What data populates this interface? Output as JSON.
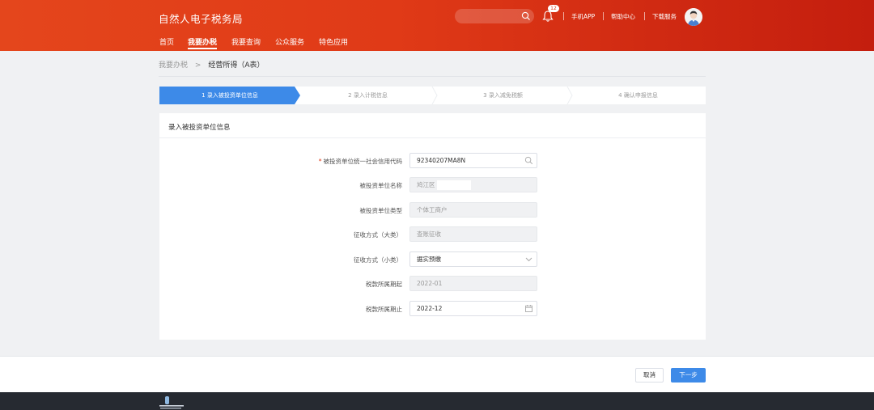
{
  "header": {
    "app_title": "自然人电子税务局",
    "notification_count": "12",
    "links": [
      "手机APP",
      "帮助中心",
      "下载服务"
    ],
    "nav": [
      "首页",
      "我要办税",
      "我要查询",
      "公众服务",
      "特色应用"
    ],
    "active_nav": "我要办税"
  },
  "breadcrumb": {
    "parent": "我要办税",
    "separator": ">",
    "current": "经营所得（A表）"
  },
  "steps": [
    {
      "label": "1  录入被投资单位信息",
      "active": true
    },
    {
      "label": "2  录入计税信息",
      "active": false
    },
    {
      "label": "3  录入减免税额",
      "active": false
    },
    {
      "label": "4  确认申报信息",
      "active": false
    }
  ],
  "card": {
    "title": "录入被投资单位信息",
    "fields": [
      {
        "label": "被投资单位统一社会信用代码",
        "required": true,
        "value": "92340207MA8N",
        "disabled": false,
        "icon": "search-icon"
      },
      {
        "label": "被投资单位名称",
        "required": false,
        "value": "鸠江区",
        "disabled": true
      },
      {
        "label": "被投资单位类型",
        "required": false,
        "value": "个体工商户",
        "disabled": true
      },
      {
        "label": "征收方式（大类）",
        "required": false,
        "value": "查账征收",
        "disabled": true
      },
      {
        "label": "征收方式（小类）",
        "required": false,
        "value": "据实预缴",
        "disabled": false,
        "icon": "chevron-down-icon"
      },
      {
        "label": "税款所属期起",
        "required": false,
        "value": "2022-01",
        "disabled": true
      },
      {
        "label": "税款所属期止",
        "required": false,
        "value": "2022-12",
        "disabled": false,
        "icon": "calendar-icon"
      }
    ]
  },
  "actions": {
    "cancel": "取消",
    "next": "下一步"
  },
  "colors": {
    "header_red": "#e03a17",
    "primary_blue": "#3d8ae8"
  }
}
